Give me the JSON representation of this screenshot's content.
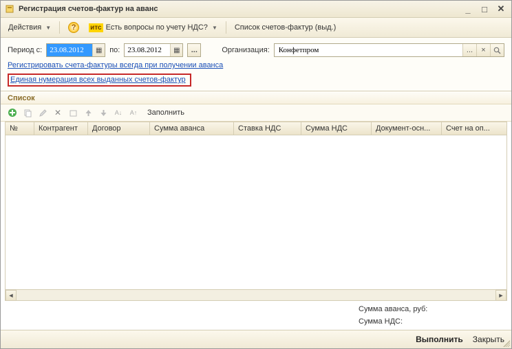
{
  "title": "Регистрация счетов-фактур на аванс",
  "toolbar": {
    "actions_label": "Действия",
    "question_label": "Есть вопросы по учету НДС?",
    "invoice_list_label": "Список счетов-фактур (выд.)"
  },
  "params": {
    "period_label": "Период с:",
    "period_to_label": "по:",
    "date_from": "23.08.2012",
    "date_to": "23.08.2012",
    "org_label": "Организация:",
    "org_value": "Конфетпром"
  },
  "links": {
    "register_always": "Регистрировать счета-фактуры всегда при получении аванса",
    "unified_numbering": "Единая нумерация всех выданных счетов-фактур"
  },
  "list": {
    "section_title": "Список",
    "fill_label": "Заполнить",
    "columns": {
      "num": "№",
      "contractor": "Контрагент",
      "contract": "Договор",
      "advance_sum": "Сумма аванса",
      "vat_rate": "Ставка НДС",
      "vat_sum": "Сумма НДС",
      "doc_basis": "Документ-осн...",
      "pay_account": "Счет на оп..."
    }
  },
  "totals": {
    "advance_label": "Сумма аванса, руб:",
    "vat_label": "Сумма НДС:"
  },
  "footer": {
    "execute": "Выполнить",
    "close": "Закрыть"
  }
}
